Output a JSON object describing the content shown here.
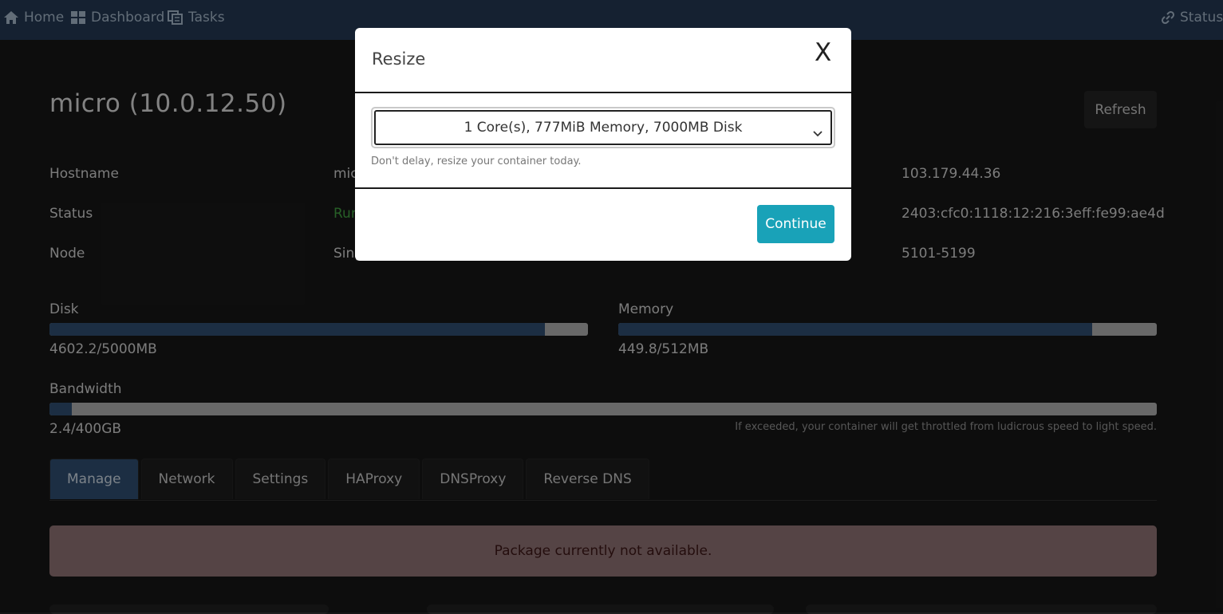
{
  "nav": {
    "home": "Home",
    "dashboard": "Dashboard",
    "tasks": "Tasks",
    "status": "Status"
  },
  "page": {
    "title": "micro (10.0.12.50)",
    "refresh": "Refresh"
  },
  "info": {
    "hostname_label": "Hostname",
    "hostname_value": "micr",
    "status_label": "Status",
    "status_value": "Run",
    "node_label": "Node",
    "node_value": "Sing",
    "ipv4": "103.179.44.36",
    "ipv6": "2403:cfc0:1118:12:216:3eff:fe99:ae4d",
    "ports": "5101-5199"
  },
  "usage": {
    "disk_label": "Disk",
    "disk_value": "4602.2/5000MB",
    "disk_fraction": 0.92,
    "memory_label": "Memory",
    "memory_value": "449.8/512MB",
    "memory_fraction": 0.88,
    "bandwidth_label": "Bandwidth",
    "bandwidth_value": "2.4/400GB",
    "bandwidth_fraction": 0.02,
    "bandwidth_note": "If exceeded, your container will get throttled from ludicrous speed to light speed."
  },
  "tabs": [
    "Manage",
    "Network",
    "Settings",
    "HAProxy",
    "DNSProxy",
    "Reverse DNS"
  ],
  "alert": "Package currently not available.",
  "modal": {
    "title": "Resize",
    "close": "X",
    "selected_option": "1 Core(s), 777MiB Memory, 7000MB Disk",
    "help": "Don't delay, resize your container today.",
    "continue": "Continue"
  },
  "colors": {
    "nav_bg": "#22364f",
    "bar_fill": "#2e4b6c",
    "continue_btn": "#19a2b8",
    "alert_bg": "#8a6f70",
    "status_running": "#3f9a3f"
  }
}
